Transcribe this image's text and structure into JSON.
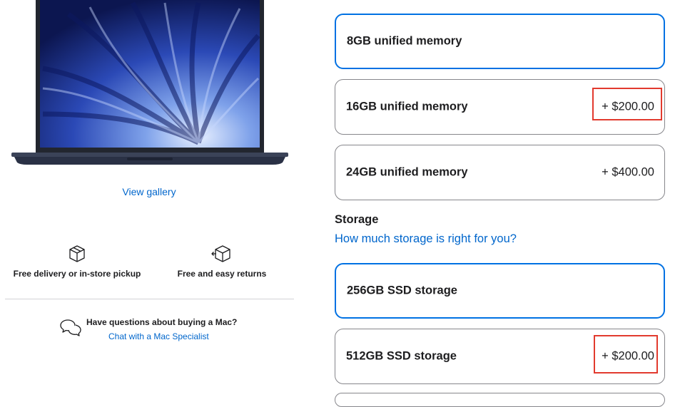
{
  "left": {
    "gallery_link": "View gallery",
    "features": [
      {
        "icon": "box-icon",
        "label": "Free delivery or in-store pickup"
      },
      {
        "icon": "return-box-icon",
        "label": "Free and easy returns"
      }
    ],
    "help": {
      "icon": "chat-bubbles-icon",
      "question": "Have questions about buying a Mac?",
      "link": "Chat with a Mac Specialist"
    }
  },
  "memory_options": [
    {
      "label": "8GB unified memory",
      "price": "",
      "selected": true
    },
    {
      "label": "16GB unified memory",
      "price": "+ $200.00",
      "selected": false
    },
    {
      "label": "24GB unified memory",
      "price": "+ $400.00",
      "selected": false
    }
  ],
  "storage": {
    "title": "Storage",
    "help_link": "How much storage is right for you?",
    "options": [
      {
        "label": "256GB SSD storage",
        "price": "",
        "selected": true
      },
      {
        "label": "512GB SSD storage",
        "price": "+ $200.00",
        "selected": false
      }
    ]
  },
  "colors": {
    "accent_blue": "#0071e3",
    "link_blue": "#0066cc",
    "highlight_red": "#e23a2e"
  }
}
